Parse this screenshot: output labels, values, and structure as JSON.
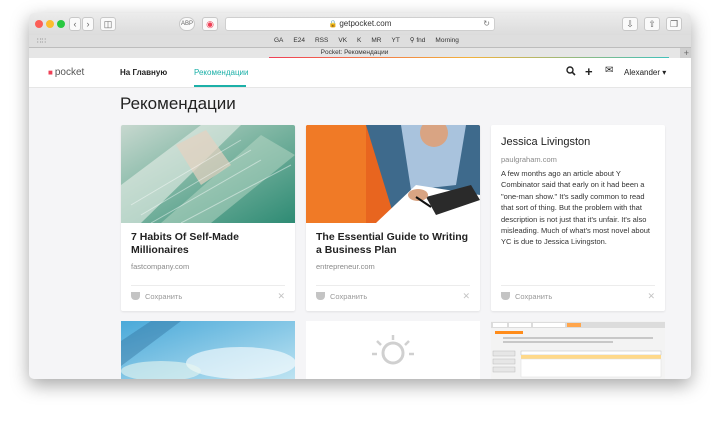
{
  "browser": {
    "url": "getpocket.com",
    "tab_title": "Pocket: Рекомендации",
    "bookmarks": [
      "GA",
      "E24",
      "RSS",
      "VK",
      "K",
      "MR",
      "YT",
      "fnd",
      "Morning"
    ]
  },
  "nav": {
    "logo": "pocket",
    "home": "На Главную",
    "recommended": "Рекомендации",
    "user": "Alexander"
  },
  "page_title": "Рекомендации",
  "save_label": "Сохранить",
  "cards": [
    {
      "title": "7 Habits Of Self-Made Millionaires",
      "domain": "fastcompany.com"
    },
    {
      "title": "The Essential Guide to Writing a Business Plan",
      "domain": "entrepreneur.com"
    },
    {
      "title": "Jessica Livingston",
      "domain": "paulgraham.com",
      "excerpt": "A few months ago an article about Y Combinator said that early on it had been a \"one-man show.\" It's sadly common to read that sort of thing. But the problem with that description is not just that it's unfair. It's also misleading. Much of what's most novel about YC is due to Jessica Livingston."
    }
  ],
  "colors": {
    "accent": "#1cb0a8",
    "pocket_red": "#ef4056"
  }
}
